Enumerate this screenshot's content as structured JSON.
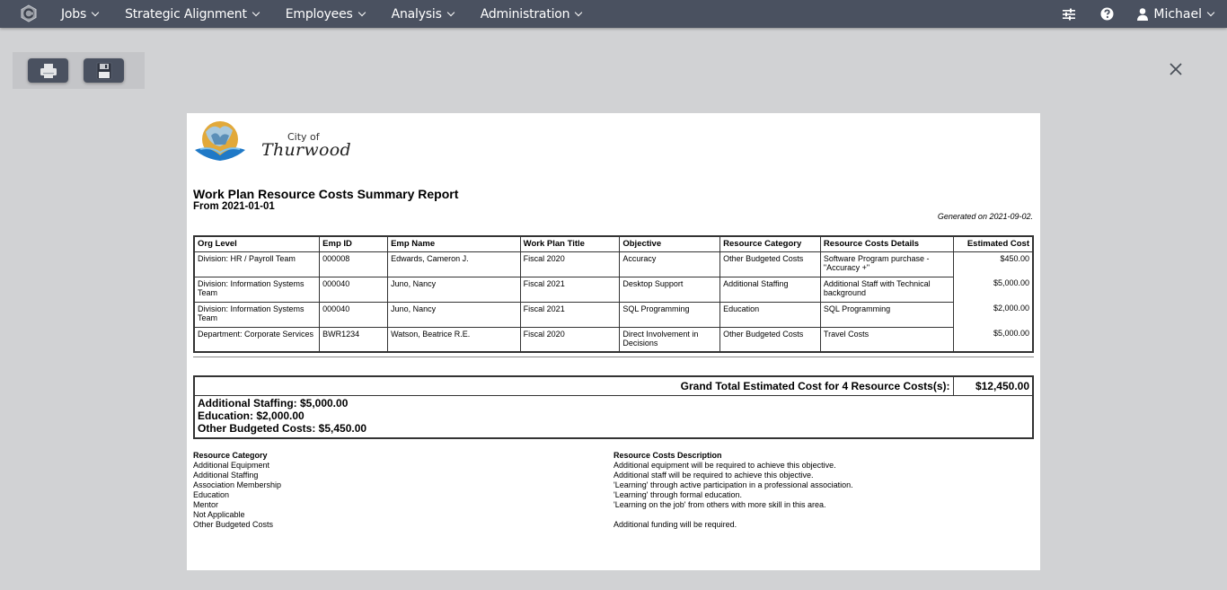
{
  "nav": {
    "items": [
      {
        "label": "Jobs"
      },
      {
        "label": "Strategic Alignment"
      },
      {
        "label": "Employees"
      },
      {
        "label": "Analysis"
      },
      {
        "label": "Administration"
      }
    ],
    "user": "Michael",
    "icons": [
      "app-logo-icon",
      "settings-sliders-icon",
      "help-icon",
      "user-icon"
    ]
  },
  "toolbar": {
    "print_icon": "print-icon",
    "save_icon": "save-icon",
    "close_icon": "close-icon"
  },
  "report": {
    "brand_prefix": "City of",
    "brand_name": "Thurwood",
    "title": "Work Plan Resource Costs Summary Report",
    "from": "From 2021-01-01",
    "generated": "Generated on 2021-09-02.",
    "columns": [
      "Org Level",
      "Emp ID",
      "Emp Name",
      "Work Plan Title",
      "Objective",
      "Resource Category",
      "Resource Costs Details",
      "Estimated Cost"
    ],
    "rows": [
      {
        "org": "Division: HR / Payroll Team",
        "emp_id": "000008",
        "emp_name": "Edwards, Cameron J.",
        "plan": "Fiscal 2020",
        "objective": "Accuracy",
        "category": "Other Budgeted Costs",
        "details": "Software Program purchase - \"Accuracy +\"",
        "cost": "$450.00"
      },
      {
        "org": "Division: Information Systems Team",
        "emp_id": "000040",
        "emp_name": "Juno, Nancy",
        "plan": "Fiscal 2021",
        "objective": "Desktop Support",
        "category": "Additional Staffing",
        "details": "Additional Staff with Technical background",
        "cost": "$5,000.00"
      },
      {
        "org": "Division: Information Systems Team",
        "emp_id": "000040",
        "emp_name": "Juno, Nancy",
        "plan": "Fiscal 2021",
        "objective": "SQL Programming",
        "category": "Education",
        "details": "SQL Programming",
        "cost": "$2,000.00"
      },
      {
        "org": "Department: Corporate Services",
        "emp_id": "BWR1234",
        "emp_name": "Watson, Beatrice R.E.",
        "plan": "Fiscal 2020",
        "objective": "Direct Involvement in Decisions",
        "category": "Other Budgeted Costs",
        "details": "Travel Costs",
        "cost": "$5,000.00"
      }
    ],
    "grand_total_label": "Grand Total Estimated Cost for 4 Resource Costs(s):",
    "grand_total_value": "$12,450.00",
    "subtotals": [
      "Additional Staffing: $5,000.00",
      "Education: $2,000.00",
      "Other Budgeted Costs: $5,450.00"
    ],
    "legend": {
      "category_header": "Resource Category",
      "description_header": "Resource Costs Description",
      "categories": [
        "Additional Equipment",
        "Additional Staffing",
        "Association Membership",
        "Education",
        "Mentor",
        "Not Applicable",
        "Other Budgeted Costs"
      ],
      "descriptions": [
        "Additional equipment will be required to achieve this objective.",
        "Additional staff will be required to achieve this objective.",
        "'Learning' through active participation in a professional association.",
        "'Learning' through formal education.",
        "'Learning on the job' from others with more skill in this area.",
        "",
        "Additional funding will be required."
      ]
    }
  }
}
